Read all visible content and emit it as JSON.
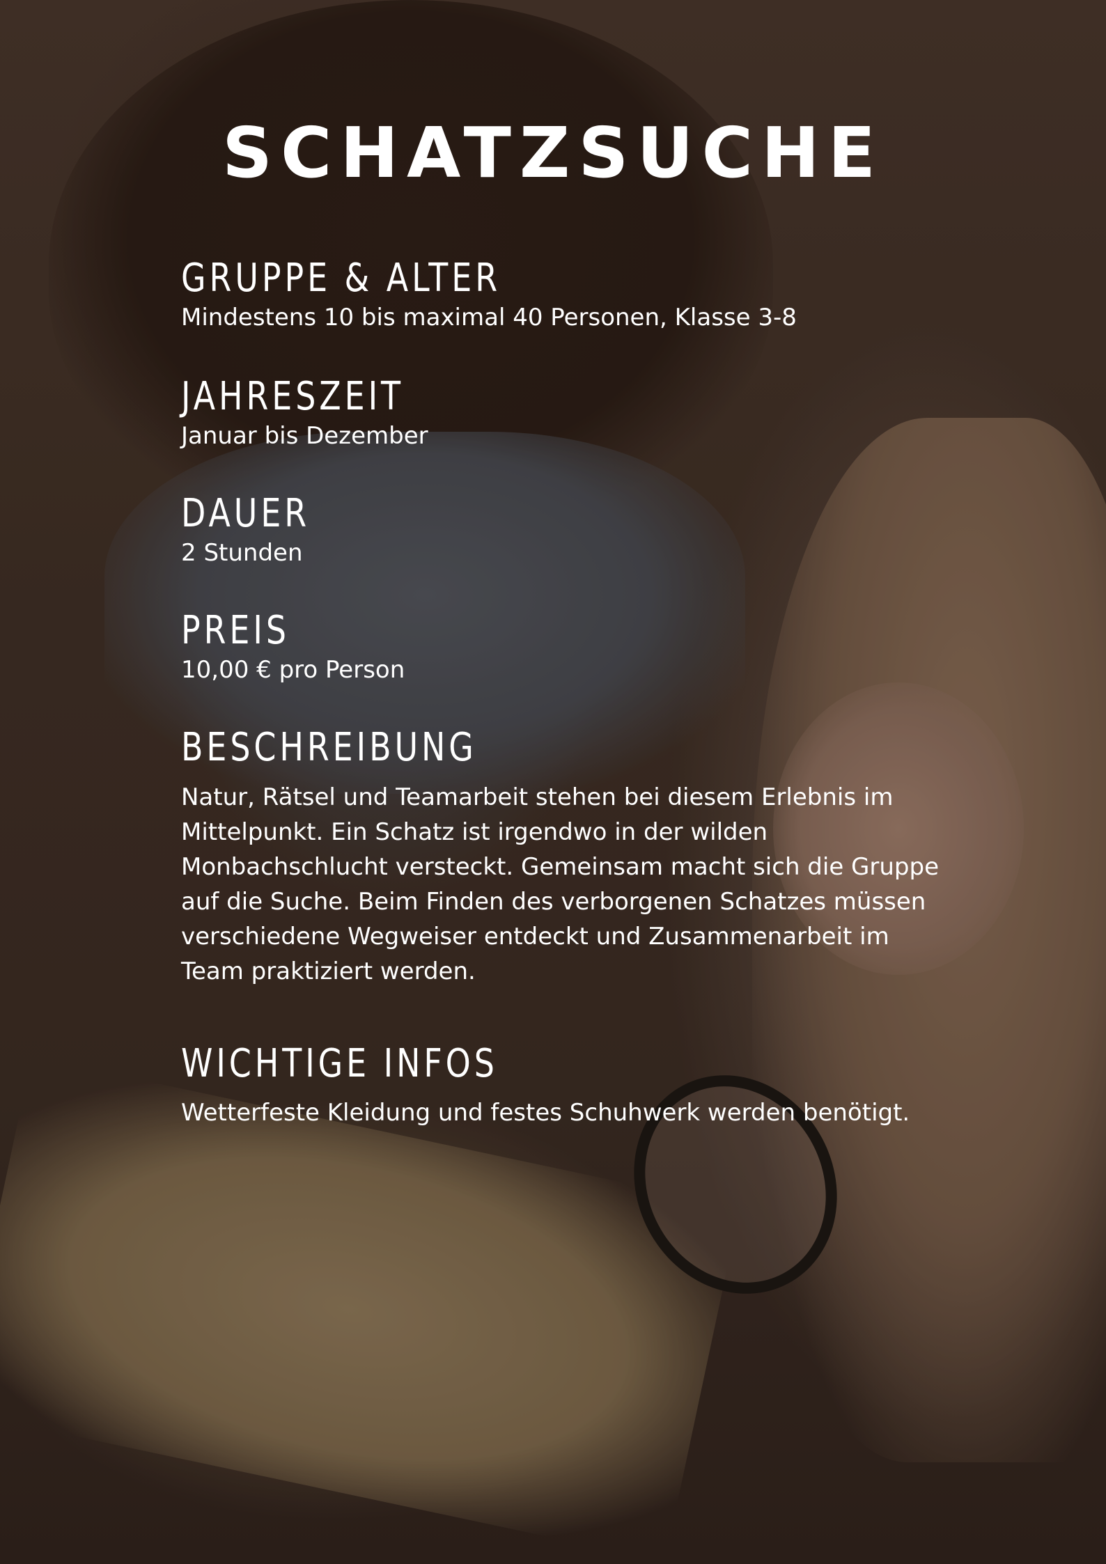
{
  "title": "SCHATZSUCHE",
  "sections": [
    {
      "heading": "GRUPPE & ALTER",
      "text": "Mindestens 10 bis maximal 40 Personen, Klasse 3-8"
    },
    {
      "heading": "JAHRESZEIT",
      "text": "Januar bis Dezember"
    },
    {
      "heading": "DAUER",
      "text": "2 Stunden"
    },
    {
      "heading": "PREIS",
      "text": "10,00 € pro Person"
    }
  ],
  "beschreibung": {
    "heading": "BESCHREIBUNG",
    "lines": [
      "Natur, Rätsel und Teamarbeit stehen bei diesem Erlebnis im",
      "Mittelpunkt. Ein Schatz ist irgendwo in der wilden",
      "Monbachschlucht versteckt. Gemeinsam macht sich die Gruppe",
      "auf die Suche. Beim Finden des verborgenen Schatzes müssen",
      "verschiedene Wegweiser entdeckt und Zusammenarbeit im",
      "Team praktiziert werden."
    ]
  },
  "infos": {
    "heading": "WICHTIGE INFOS",
    "text": "Wetterfeste Kleidung und festes Schuhwerk werden benötigt."
  }
}
